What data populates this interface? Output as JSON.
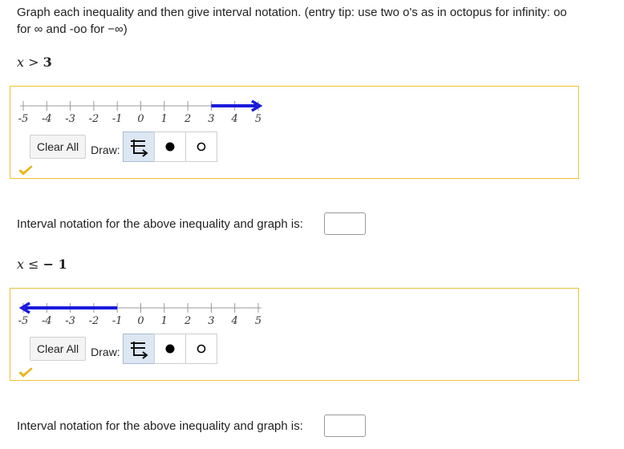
{
  "instructions": "Graph each inequality and then give interval notation. (entry tip: use two o's as in octopus for infinity: oo for ∞ and -oo for −∞)",
  "problems": [
    {
      "inequality": {
        "variable": "x",
        "operator": ">",
        "value": "3"
      },
      "number_line": {
        "ticks": [
          "-5",
          "-4",
          "-3",
          "-2",
          "-1",
          "0",
          "1",
          "2",
          "3",
          "4",
          "5"
        ],
        "shaded_from": 3,
        "shaded_to": 5,
        "arrow": "right",
        "color": "#1a1adb"
      },
      "clear_label": "Clear All",
      "draw_label": "Draw:",
      "interval_prompt": "Interval notation for the above inequality and graph is:",
      "answer_value": ""
    },
    {
      "inequality": {
        "variable": "x",
        "operator": "≤",
        "value": "− 1"
      },
      "number_line": {
        "ticks": [
          "-5",
          "-4",
          "-3",
          "-2",
          "-1",
          "0",
          "1",
          "2",
          "3",
          "4",
          "5"
        ],
        "shaded_from": -5,
        "shaded_to": -1,
        "arrow": "left",
        "color": "#1a1adb"
      },
      "clear_label": "Clear All",
      "draw_label": "Draw:",
      "interval_prompt": "Interval notation for the above inequality and graph is:",
      "answer_value": ""
    }
  ],
  "colors": {
    "box_border": "#e8c33a",
    "check": "#f2c01e",
    "line": "#1a1adb"
  },
  "icons": [
    "ray-tool-icon",
    "closed-dot-icon",
    "open-dot-icon",
    "checkmark-icon"
  ]
}
